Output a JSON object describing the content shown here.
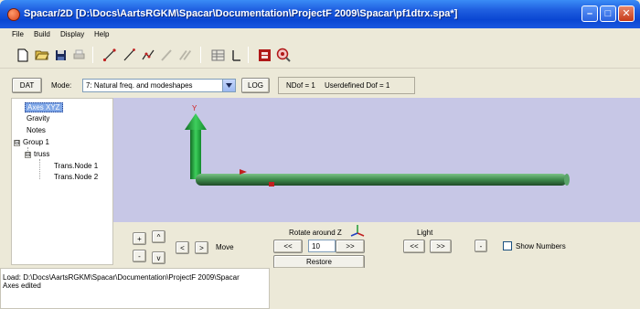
{
  "window": {
    "title": "Spacar/2D   [D:\\Docs\\AartsRGKM\\Spacar\\Documentation\\ProjectF 2009\\Spacar\\pf1dtrx.spa*]",
    "app_icon": "spacar-app-icon",
    "controls": {
      "minimize": "minimize-icon",
      "maximize": "maximize-icon",
      "close": "close-icon"
    }
  },
  "menu": [
    "File",
    "Build",
    "Display",
    "Help"
  ],
  "toolbar": {
    "icons": [
      "new-icon",
      "open-icon",
      "save-icon",
      "print-icon",
      "node-tool-icon",
      "line-tool-icon",
      "hinge-tool-icon",
      "beam-tool-icon",
      "truss-tool-icon",
      "table-icon",
      "axis-icon",
      "frame-icon",
      "target-icon"
    ]
  },
  "modebar": {
    "dat_label": "DAT",
    "mode_label": "Mode:",
    "mode_selected": "7: Natural freq. and modeshapes",
    "log_label": "LOG",
    "ndof_text": "NDof = 1",
    "userdef_text": "Userdefined Dof = 1"
  },
  "tree": {
    "items": [
      {
        "label": "Axes XYZ",
        "selected": true
      },
      {
        "label": "Gravity"
      },
      {
        "label": "Notes"
      },
      {
        "label": "Group 1"
      },
      {
        "label": "truss"
      },
      {
        "label": "Trans.Node 1"
      },
      {
        "label": "Trans.Node 2"
      }
    ],
    "expander_symbol": "⊟"
  },
  "viewport": {
    "axis_label": "Y",
    "background": "#c7c7e6",
    "beam_color": "#2f7a3c",
    "axis_color": "#1e9a36"
  },
  "controls": {
    "plus": "+",
    "minus": "-",
    "up": "^",
    "down": "v",
    "left": "<",
    "right": ">",
    "move_label": "Move",
    "rotate_label": "Rotate around Z",
    "rot_left": "<<",
    "rot_right": ">>",
    "rot_value": "10",
    "restore_label": "Restore",
    "light_label": "Light",
    "light_left": "<<",
    "light_right": ">>",
    "dot_label": "-",
    "show_numbers_label": "Show Numbers"
  },
  "log": {
    "lines": [
      "Load: D:\\Docs\\AartsRGKM\\Spacar\\Documentation\\ProjectF 2009\\Spacar",
      "Axes edited"
    ]
  }
}
